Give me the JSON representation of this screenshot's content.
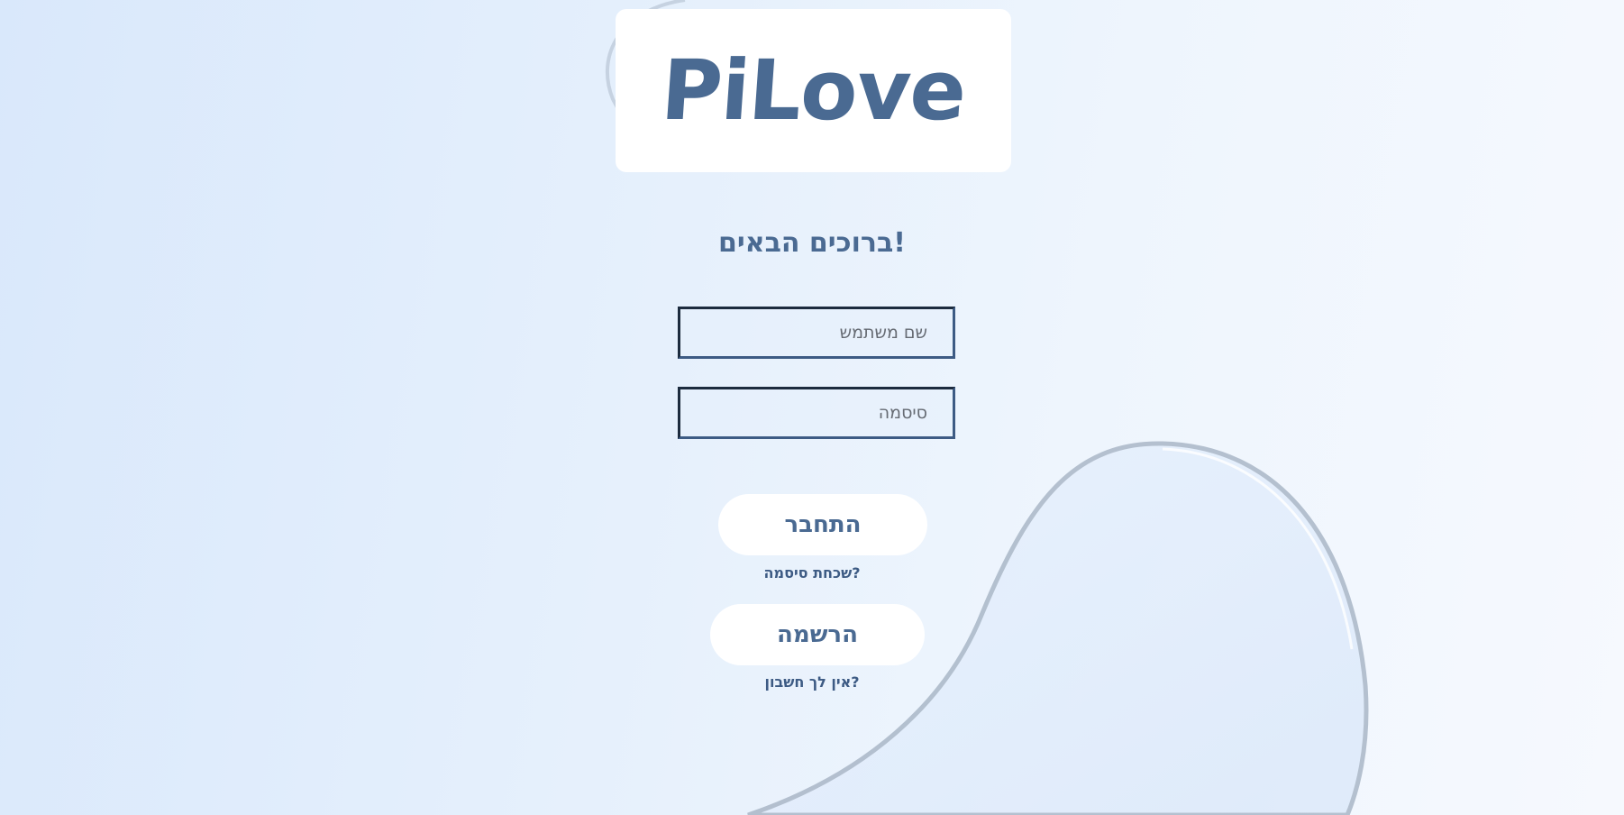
{
  "brand": {
    "logo_text": "PiLove",
    "color": "#4a6a92"
  },
  "welcome": {
    "title": "ברוכים הבאים!"
  },
  "login_form": {
    "username_placeholder": "שם משתמש",
    "password_placeholder": "סיסמה",
    "login_label": "התחבר",
    "forgot_password_label": "שכחת סיסמה?",
    "register_label": "הרשמה",
    "no_account_label": "אין לך חשבון?"
  },
  "colors": {
    "accent": "#4a6a92",
    "field_border": "#1c2b3e",
    "background": "#e4effc",
    "card": "#ffffff"
  }
}
